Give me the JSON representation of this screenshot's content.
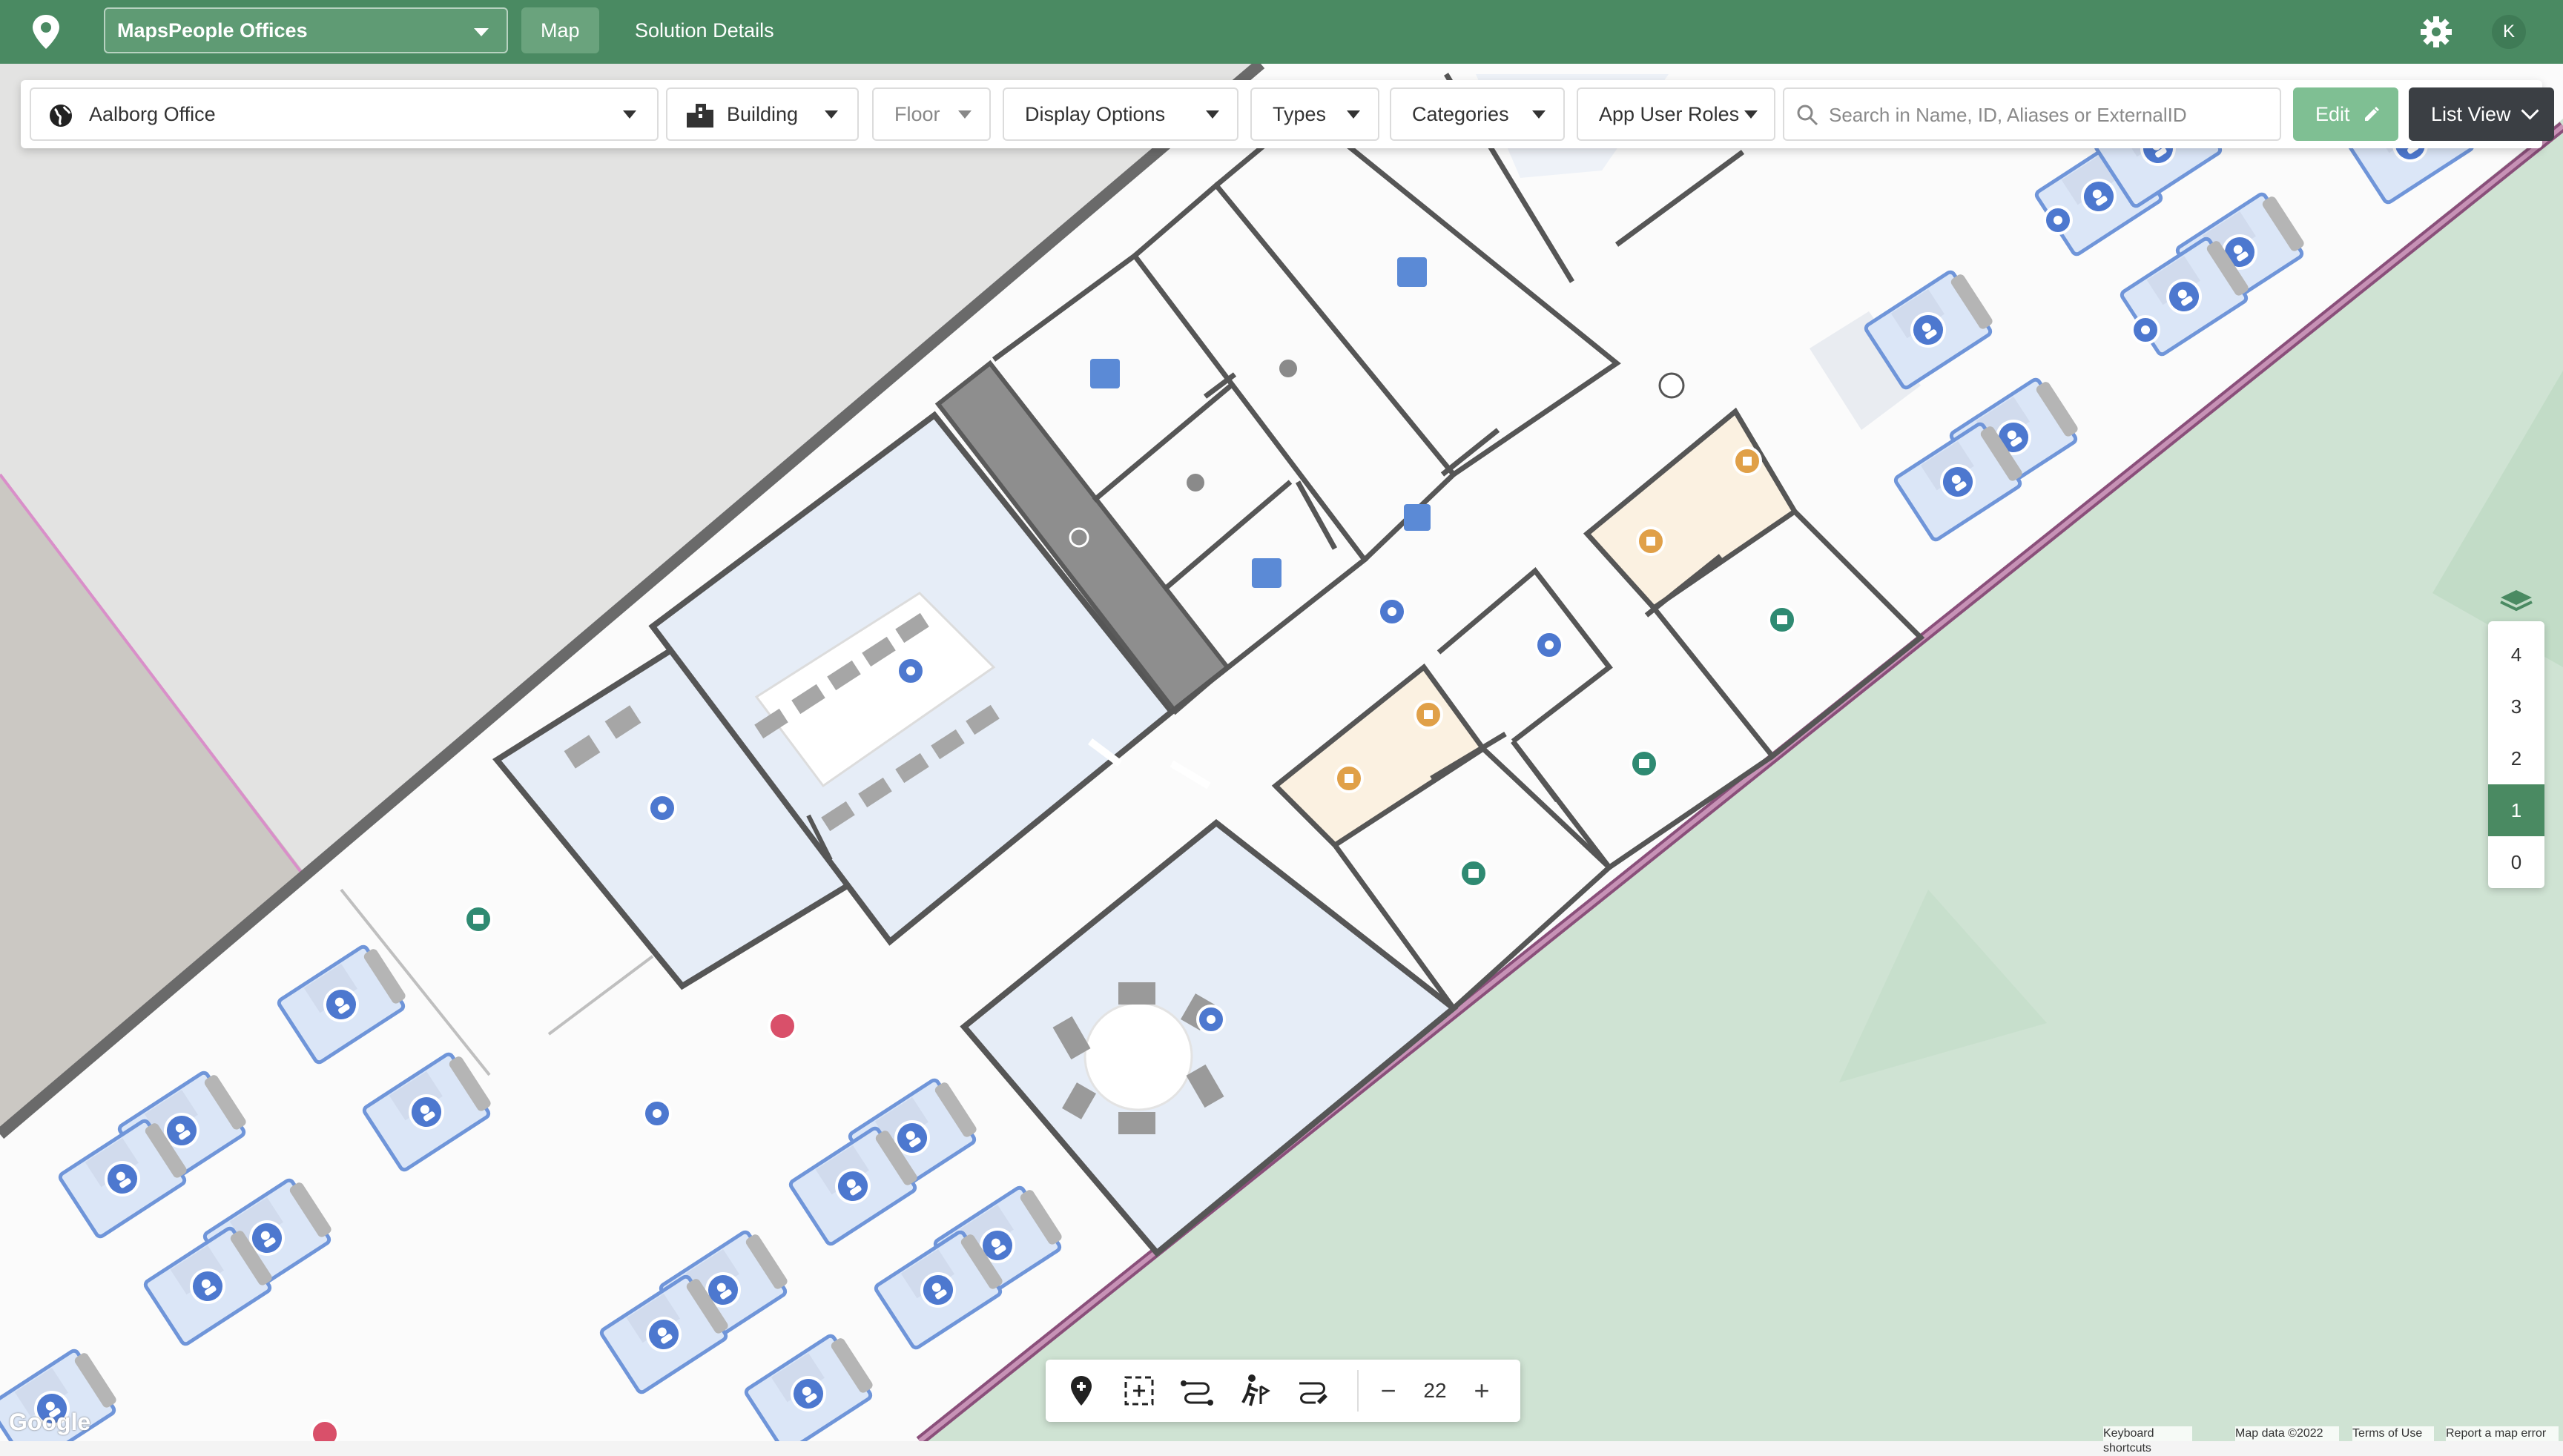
{
  "topbar": {
    "solution": "MapsPeople Offices",
    "tabs": [
      {
        "label": "Map",
        "active": true
      },
      {
        "label": "Solution Details",
        "active": false
      }
    ],
    "avatar_letter": "K",
    "color": "#4a8a62"
  },
  "toolbar": {
    "venue": "Aalborg Office",
    "building": "Building",
    "floor": "Floor",
    "display_options": "Display Options",
    "types": "Types",
    "categories": "Categories",
    "app_user_roles": "App User Roles",
    "search_placeholder": "Search in Name, ID, Aliases or ExternalID",
    "edit": "Edit",
    "list_view": "List View"
  },
  "floors": {
    "levels": [
      "4",
      "3",
      "2",
      "1",
      "0"
    ],
    "selected": "1"
  },
  "map_controls": {
    "zoom": "22",
    "zoom_out": "−",
    "zoom_in": "+",
    "tools": [
      "add-location-icon",
      "select-area-icon",
      "route-icon",
      "accessibility-route-icon",
      "route-edit-icon"
    ]
  },
  "map": {
    "google_logo": "Google",
    "footer": {
      "keyboard": "Keyboard shortcuts",
      "map_data": "Map data ©2022",
      "terms": "Terms of Use",
      "report": "Report a map error"
    },
    "colors": {
      "room": "#e6edf7",
      "wall": "#565656",
      "desk": "#7098e0",
      "accent_orange": "#e0a048",
      "accent_green": "#2f8a72",
      "accent_red": "#d9506a",
      "grass": "#cfe3d3"
    }
  }
}
